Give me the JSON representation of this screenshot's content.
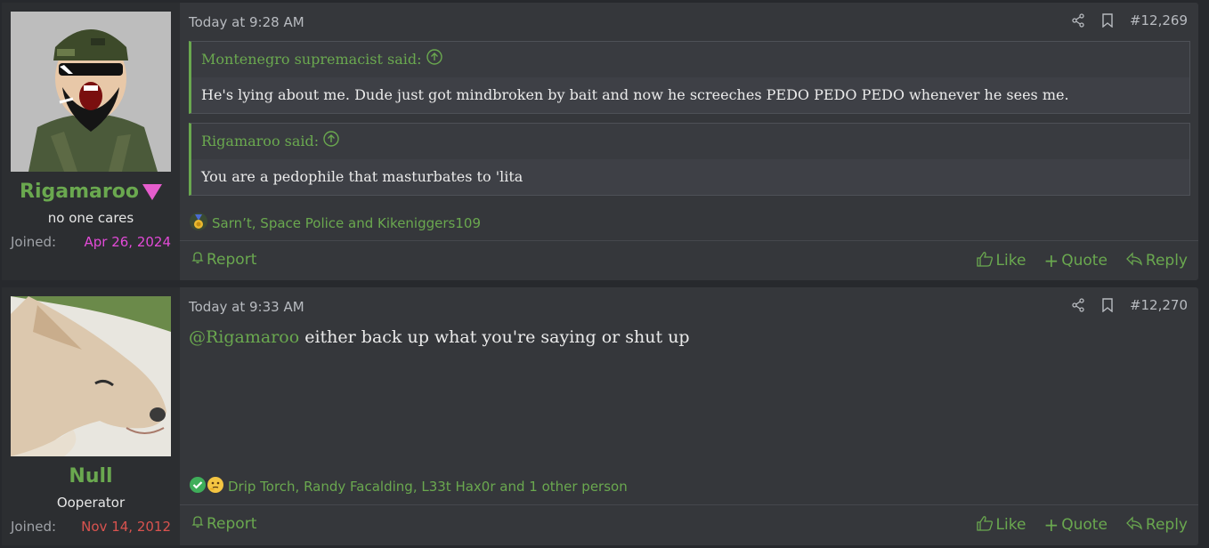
{
  "posts": [
    {
      "user": {
        "name": "Rigamaroo",
        "title": "no one cares",
        "joined_label": "Joined:",
        "joined_date": "Apr 26, 2024",
        "joined_color": "#e24ad7",
        "name_color": "#6aa84f"
      },
      "time": "Today at 9:28 AM",
      "number": "#12,269",
      "quotes": [
        {
          "author": "Montenegro supremacist said:",
          "text": "He's lying about me. Dude just got mindbroken by bait and now he screeches PEDO PEDO PEDO whenever he sees me."
        },
        {
          "author": "Rigamaroo said:",
          "text": "You are a pedophile that masturbates to 'lita"
        }
      ],
      "reactions": "Sarn’t, Space Police and Kikeniggers109",
      "footer": {
        "report": "Report",
        "like": "Like",
        "quote": "Quote",
        "reply": "Reply"
      }
    },
    {
      "user": {
        "name": "Null",
        "title": "Ooperator",
        "joined_label": "Joined:",
        "joined_date": "Nov 14, 2012",
        "joined_color": "#d9534f",
        "name_color": "#6aa84f"
      },
      "time": "Today at 9:33 AM",
      "number": "#12,270",
      "message": {
        "mention": "@Rigamaroo",
        "text": " either back up what you're saying or shut up"
      },
      "reactions": "Drip Torch, Randy Facalding, L33t Hax0r and 1 other person",
      "footer": {
        "report": "Report",
        "like": "Like",
        "quote": "Quote",
        "reply": "Reply"
      }
    }
  ],
  "icons": {
    "share": "share-icon",
    "bookmark": "bookmark-icon",
    "quote_up": "arrow-up-circle-icon",
    "bell": "bell-icon",
    "thumbs_up": "thumbs-up-icon",
    "plus": "plus-icon",
    "reply": "reply-icon"
  },
  "colors": {
    "accent": "#6aa84f",
    "post_bg": "#35373b",
    "page_bg": "#27292d"
  }
}
